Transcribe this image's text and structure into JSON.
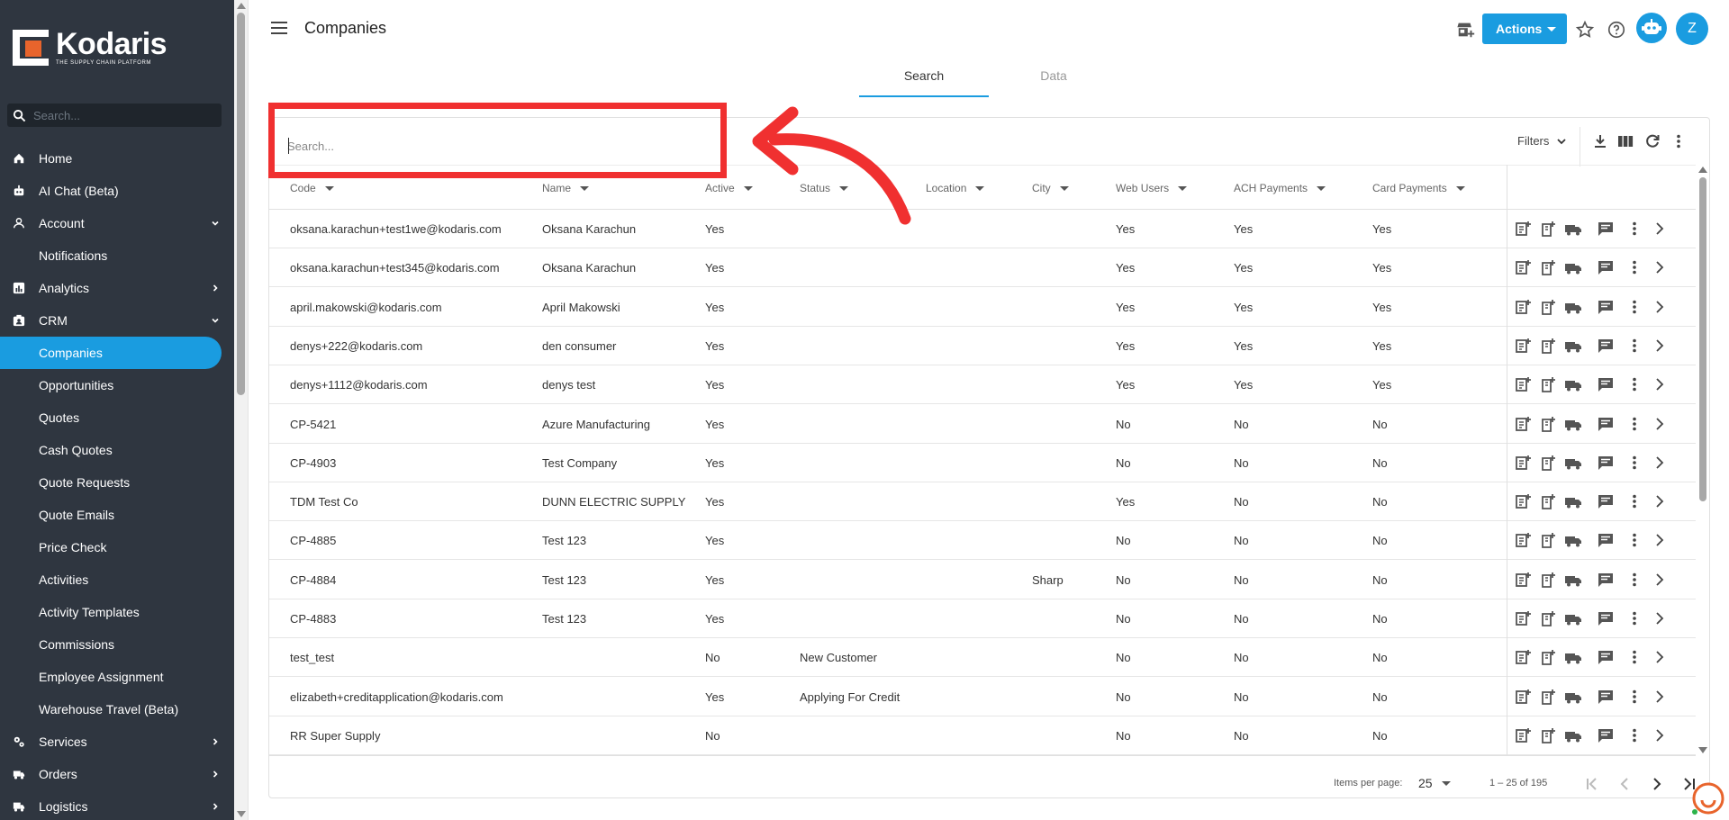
{
  "sidebar": {
    "brand_name": "Kodaris",
    "brand_tagline": "THE SUPPLY CHAIN PLATFORM",
    "search_placeholder": "Search...",
    "items": [
      {
        "label": "Home",
        "icon": "home-icon",
        "level": 0
      },
      {
        "label": "AI Chat (Beta)",
        "icon": "robot-icon",
        "level": 0
      },
      {
        "label": "Account",
        "icon": "person-icon",
        "level": 0,
        "expanded": true
      },
      {
        "label": "Notifications",
        "level": 1
      },
      {
        "label": "Analytics",
        "icon": "analytics-icon",
        "level": 0,
        "expanded": false
      },
      {
        "label": "CRM",
        "icon": "crm-icon",
        "level": 0,
        "expanded": true
      },
      {
        "label": "Companies",
        "level": 1,
        "active": true
      },
      {
        "label": "Opportunities",
        "level": 1
      },
      {
        "label": "Quotes",
        "level": 1
      },
      {
        "label": "Cash Quotes",
        "level": 1
      },
      {
        "label": "Quote Requests",
        "level": 1
      },
      {
        "label": "Quote Emails",
        "level": 1
      },
      {
        "label": "Price Check",
        "level": 1
      },
      {
        "label": "Activities",
        "level": 1
      },
      {
        "label": "Activity Templates",
        "level": 1
      },
      {
        "label": "Commissions",
        "level": 1
      },
      {
        "label": "Employee Assignment",
        "level": 1
      },
      {
        "label": "Warehouse Travel (Beta)",
        "level": 1
      },
      {
        "label": "Services",
        "icon": "services-icon",
        "level": 0,
        "expanded": false
      },
      {
        "label": "Orders",
        "icon": "truck-icon",
        "level": 0,
        "expanded": false
      },
      {
        "label": "Logistics",
        "icon": "logistics-icon",
        "level": 0,
        "expanded": false
      }
    ]
  },
  "header": {
    "title": "Companies",
    "actions_label": "Actions",
    "avatar_initial": "Z"
  },
  "tabs": [
    {
      "label": "Search",
      "active": true
    },
    {
      "label": "Data",
      "active": false
    }
  ],
  "search": {
    "placeholder": "Search...",
    "value": ""
  },
  "filters_label": "Filters",
  "table": {
    "columns": [
      "Code",
      "Name",
      "Active",
      "Status",
      "Location",
      "City",
      "Web Users",
      "ACH Payments",
      "Card Payments"
    ],
    "rows": [
      [
        "oksana.karachun+test1we@kodaris.com",
        "Oksana Karachun",
        "Yes",
        "",
        "",
        "",
        "Yes",
        "Yes",
        "Yes"
      ],
      [
        "oksana.karachun+test345@kodaris.com",
        "Oksana Karachun",
        "Yes",
        "",
        "",
        "",
        "Yes",
        "Yes",
        "Yes"
      ],
      [
        "april.makowski@kodaris.com",
        "April Makowski",
        "Yes",
        "",
        "",
        "",
        "Yes",
        "Yes",
        "Yes"
      ],
      [
        "denys+222@kodaris.com",
        "den consumer",
        "Yes",
        "",
        "",
        "",
        "Yes",
        "Yes",
        "Yes"
      ],
      [
        "denys+1112@kodaris.com",
        "denys test",
        "Yes",
        "",
        "",
        "",
        "Yes",
        "Yes",
        "Yes"
      ],
      [
        "CP-5421",
        "Azure Manufacturing",
        "Yes",
        "",
        "",
        "",
        "No",
        "No",
        "No"
      ],
      [
        "CP-4903",
        "Test Company",
        "Yes",
        "",
        "",
        "",
        "No",
        "No",
        "No"
      ],
      [
        "TDM Test Co",
        "DUNN ELECTRIC SUPPLY",
        "Yes",
        "",
        "",
        "",
        "Yes",
        "No",
        "No"
      ],
      [
        "CP-4885",
        "Test 123",
        "Yes",
        "",
        "",
        "",
        "No",
        "No",
        "No"
      ],
      [
        "CP-4884",
        "Test 123",
        "Yes",
        "",
        "",
        "Sharp",
        "No",
        "No",
        "No"
      ],
      [
        "CP-4883",
        "Test 123",
        "Yes",
        "",
        "",
        "",
        "No",
        "No",
        "No"
      ],
      [
        "test_test",
        "",
        "No",
        "New Customer",
        "",
        "",
        "No",
        "No",
        "No"
      ],
      [
        "elizabeth+creditapplication@kodaris.com",
        "",
        "Yes",
        "Applying For Credit",
        "",
        "",
        "No",
        "No",
        "No"
      ],
      [
        "RR Super Supply",
        "",
        "No",
        "",
        "",
        "",
        "No",
        "No",
        "No"
      ]
    ]
  },
  "paginator": {
    "items_per_page_label": "Items per page:",
    "items_per_page": "25",
    "range_label": "1 – 25 of 195"
  },
  "colors": {
    "accent": "#1a9ce0",
    "sidebar_bg": "#2f3640",
    "annotation": "#f03030",
    "brand_orange": "#e8642c"
  }
}
